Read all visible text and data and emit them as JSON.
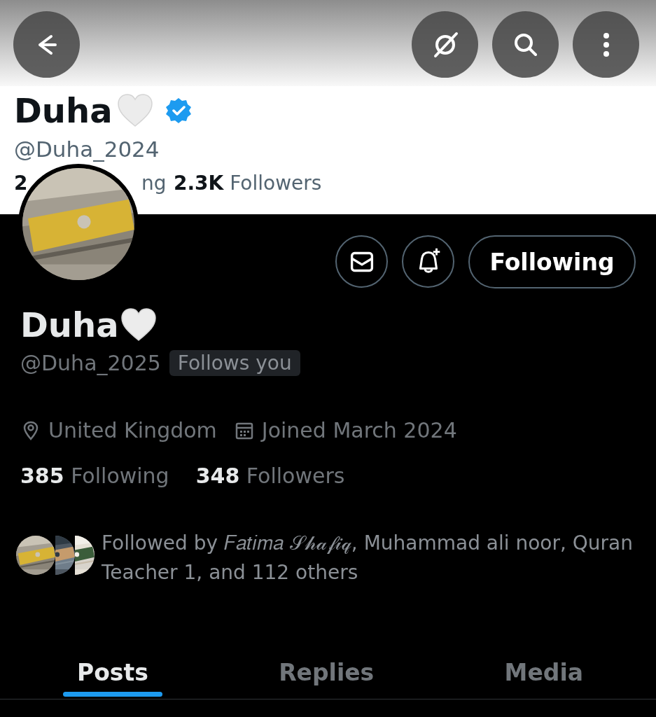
{
  "header": {
    "buttons": [
      {
        "kind": "back"
      },
      {
        "kind": "grok"
      },
      {
        "kind": "search"
      },
      {
        "kind": "more"
      }
    ]
  },
  "behind_profile": {
    "name": "Duha",
    "verified": true,
    "handle": "@Duha_2024",
    "following_count": "2",
    "following_label": "ng",
    "followers_count": "2.3K",
    "followers_label": "Followers"
  },
  "profile": {
    "actions": [
      {
        "kind": "message"
      },
      {
        "kind": "notify"
      }
    ],
    "follow_button": "Following",
    "name": "Duha",
    "handle": "@Duha_2025",
    "follows_you": "Follows you",
    "location": "United Kingdom",
    "joined": "Joined March 2024",
    "following_count": "385",
    "following_label": "Following",
    "followers_count": "348",
    "followers_label": "Followers",
    "followed_by": "Followed by 𝐹𝑎𝑡𝑖𝑚𝑎 𝒮𝒽𝒶𝒻𝒾𝓆, Muhammad ali noor, Quran Teacher 1, and 112 others"
  },
  "tabs": [
    {
      "label": "Posts",
      "selected": true
    },
    {
      "label": "Replies",
      "selected": false
    },
    {
      "label": "Media",
      "selected": false
    }
  ]
}
